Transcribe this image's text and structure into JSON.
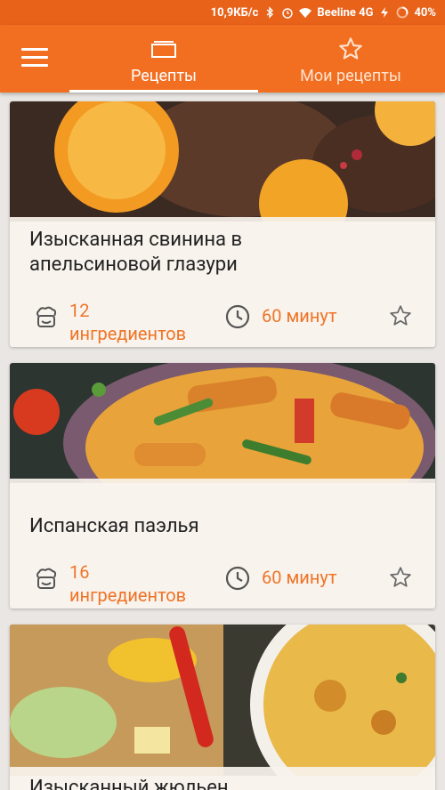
{
  "status_bar": {
    "speed": "10,9КБ/с",
    "carrier": "Beeline 4G",
    "battery": "40%",
    "icons": [
      "bluetooth-icon",
      "alarm-icon",
      "wifi-icon",
      "signal-icon",
      "charging-icon",
      "battery-icon"
    ]
  },
  "app_bar": {
    "menu_icon": "hamburger-icon",
    "tabs": [
      {
        "label": "Рецепты",
        "icon": "cards-icon",
        "selected": true
      },
      {
        "label": "Мои рецепты",
        "icon": "star-outline-icon",
        "selected": false
      }
    ]
  },
  "recipes": [
    {
      "title": "Изысканная свинина в апельсиновой глазури",
      "ingredients_count": "12",
      "ingredients_label": "ингредиентов",
      "time": "60 минут"
    },
    {
      "title": "Испанская паэлья",
      "ingredients_count": "16",
      "ingredients_label": "ингредиентов",
      "time": "60 минут"
    },
    {
      "title": "Изысканный жюльен",
      "ingredients_count": "",
      "ingredients_label": "",
      "time": ""
    }
  ],
  "colors": {
    "accent": "#f26f21",
    "accent_text": "#f07427",
    "status_bar": "#e8621a"
  }
}
